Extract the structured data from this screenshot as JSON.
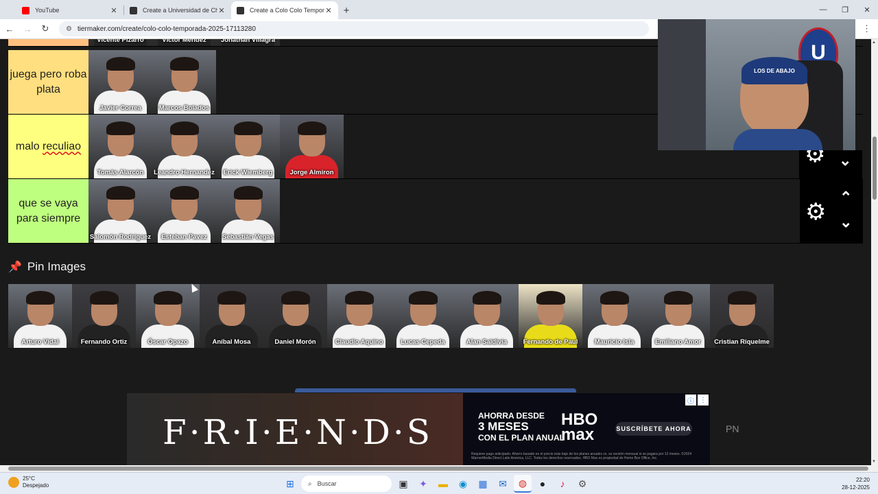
{
  "browser": {
    "tabs": [
      {
        "title": "YouTube",
        "favicon_color": "#ff0000",
        "active": false
      },
      {
        "title": "Create a Universidad de Chile Ti",
        "favicon_color": "#333333",
        "active": false
      },
      {
        "title": "Create a Colo Colo Temporada",
        "favicon_color": "#333333",
        "active": true
      }
    ],
    "new_tab": "+",
    "url": "tiermaker.com/create/colo-colo-temporada-2025-17113280",
    "window_controls": {
      "minimize": "—",
      "maximize": "❐",
      "close": "✕"
    }
  },
  "tiers": [
    {
      "label": "",
      "color": "#ffbf7f",
      "items": [
        {
          "name": "Vicente Pizarro",
          "style": "dark"
        },
        {
          "name": "Víctor Méndez",
          "style": "dark"
        },
        {
          "name": "Jonathan Villagra",
          "style": "dark"
        }
      ]
    },
    {
      "label": "juega pero roba plata",
      "color": "#ffdf7f",
      "items": [
        {
          "name": "Javier Correa",
          "style": "white"
        },
        {
          "name": "Marcos Bolados",
          "style": "white"
        }
      ]
    },
    {
      "label": "malo reculiao",
      "label_a": "malo ",
      "label_b": "reculiao",
      "color": "#ffff7f",
      "items": [
        {
          "name": "Tomás Alarcón",
          "style": "white"
        },
        {
          "name": "Leandro Hernandez",
          "style": "white"
        },
        {
          "name": "Erick Wiemberg",
          "style": "white"
        },
        {
          "name": "Jorge Almiron",
          "style": "red"
        }
      ]
    },
    {
      "label": "que se vaya para siempre",
      "color": "#bfff7f",
      "items": [
        {
          "name": "Salomón Rodríguez",
          "style": "white"
        },
        {
          "name": "Esteban Pavez",
          "style": "white"
        },
        {
          "name": "Sebastián Vegas",
          "style": "white"
        }
      ]
    }
  ],
  "pin_images": {
    "title": "Pin Images",
    "items": [
      {
        "name": "Arturo Vidal",
        "style": "white"
      },
      {
        "name": "Fernando Ortiz",
        "style": "dark"
      },
      {
        "name": "Óscar Opazo",
        "style": "white"
      },
      {
        "name": "Aníbal Mosa",
        "style": "dark"
      },
      {
        "name": "Daniel Morón",
        "style": "dark"
      },
      {
        "name": "Claudio Aquino",
        "style": "white"
      },
      {
        "name": "Lucas Cepeda",
        "style": "white"
      },
      {
        "name": "Alan Saldivia",
        "style": "white"
      },
      {
        "name": "Fernando de Paul",
        "style": "yellow"
      },
      {
        "name": "Mauricio Isla",
        "style": "white"
      },
      {
        "name": "Emiliano Amor",
        "style": "white"
      },
      {
        "name": "Cristian Riquelme",
        "style": "dark"
      }
    ]
  },
  "ad": {
    "headline": "F·R·I·E·N·D·S",
    "promo_line1": "AHORRA DESDE",
    "promo_line2": "3 MESES",
    "promo_line3": "CON EL PLAN ANUAL",
    "brand_line1": "HBO",
    "brand_line2": "max",
    "cta": "SUSCRÍBETE AHORA",
    "fine_print": "Requiere pago anticipado. Ahorro basado en el precio más bajo de los planes anuales vs. su versión mensual si se pagara por 12 meses. ©2024 WarnerMedia Direct Latin America, LLC. Todos los derechos reservados. HBO Max es propiedad de Home Box Office, Inc.",
    "side_text": "PN"
  },
  "webcam": {
    "cap_text": "LOS DE ABAJO",
    "logo_letter": "U"
  },
  "taskbar": {
    "temperature": "25°C",
    "weather": "Despejado",
    "search_placeholder": "Buscar",
    "time": "22:20",
    "date": "28-12-2025"
  }
}
